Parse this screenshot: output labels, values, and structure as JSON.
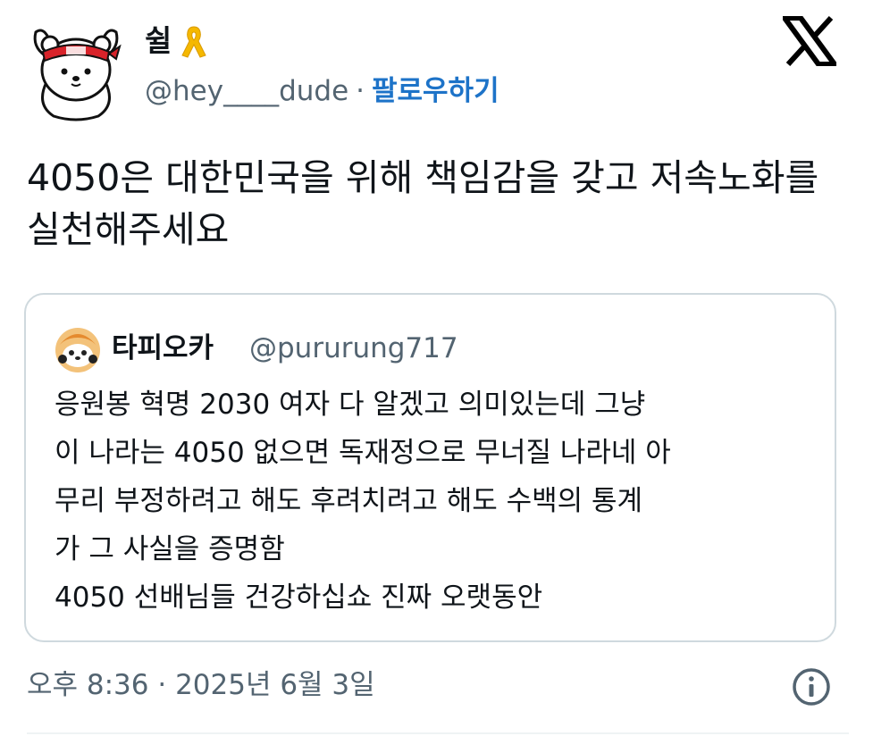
{
  "author": {
    "display_name": "쉴",
    "ribbon_icon": "yellow-ribbon-icon",
    "handle": "@hey____dude",
    "separator": "·",
    "follow_label": "팔로우하기"
  },
  "tweet": {
    "text": "4050은 대한민국을 위해 책임감을 갖고 저속노화를 실천해주세요"
  },
  "quoted": {
    "display_name": "타피오카",
    "handle": "@pururung717",
    "lines": [
      "응원봉 혁명 2030 여자 다 알겠고 의미있는데 그냥",
      "이 나라는 4050 없으면 독재정으로 무너질 나라네 아",
      "무리 부정하려고 해도 후려치려고 해도 수백의 통계",
      "가 그 사실을 증명함",
      "4050 선배님들 건강하십쇼 진짜 오랫동안"
    ]
  },
  "meta": {
    "timestamp": "오후 8:36 · 2025년 6월 3일"
  },
  "colors": {
    "text": "#0f1419",
    "secondary": "#536471",
    "link": "#1d73c8",
    "border": "#cfd9de",
    "ribbon": "#f5b800"
  },
  "icons": {
    "logo": "x-logo-icon",
    "info": "info-icon"
  }
}
